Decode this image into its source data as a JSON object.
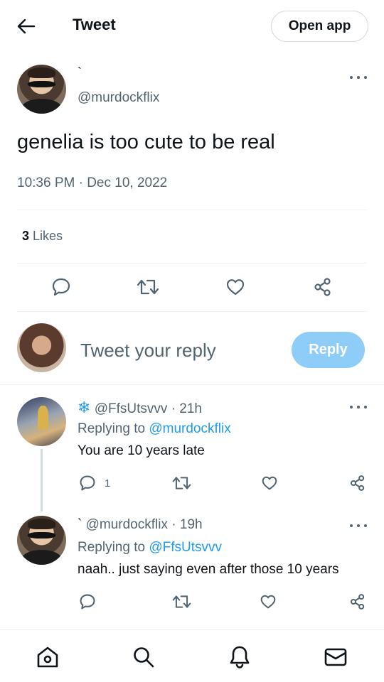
{
  "header": {
    "title": "Tweet",
    "open_app_label": "Open app"
  },
  "tweet": {
    "display_name": "`",
    "handle": "@murdockflix",
    "text": "genelia is too cute to be real",
    "timestamp": "10:36 PM · Dec 10, 2022",
    "likes_count": "3",
    "likes_label": "Likes"
  },
  "compose": {
    "placeholder": "Tweet your reply",
    "reply_label": "Reply"
  },
  "replies": [
    {
      "name_icon": "snowflake-icon",
      "name_glyph": "❄",
      "handle": "@FfsUtsvvv",
      "time": "21h",
      "replying_prefix": "Replying to",
      "replying_to": "@murdockflix",
      "text": "You are 10 years late",
      "reply_count": "1"
    },
    {
      "display_name": "`",
      "handle": "@murdockflix",
      "time": "19h",
      "replying_prefix": "Replying to",
      "replying_to": "@FfsUtsvvv",
      "text": "naah.. just saying even after those 10 years"
    }
  ],
  "colors": {
    "accent": "#1d9bf0",
    "reply_button": "#8ecdf8",
    "secondary_text": "#536471",
    "primary_text": "#0f1419"
  },
  "nav": [
    "home-icon",
    "search-icon",
    "notifications-icon",
    "messages-icon"
  ]
}
